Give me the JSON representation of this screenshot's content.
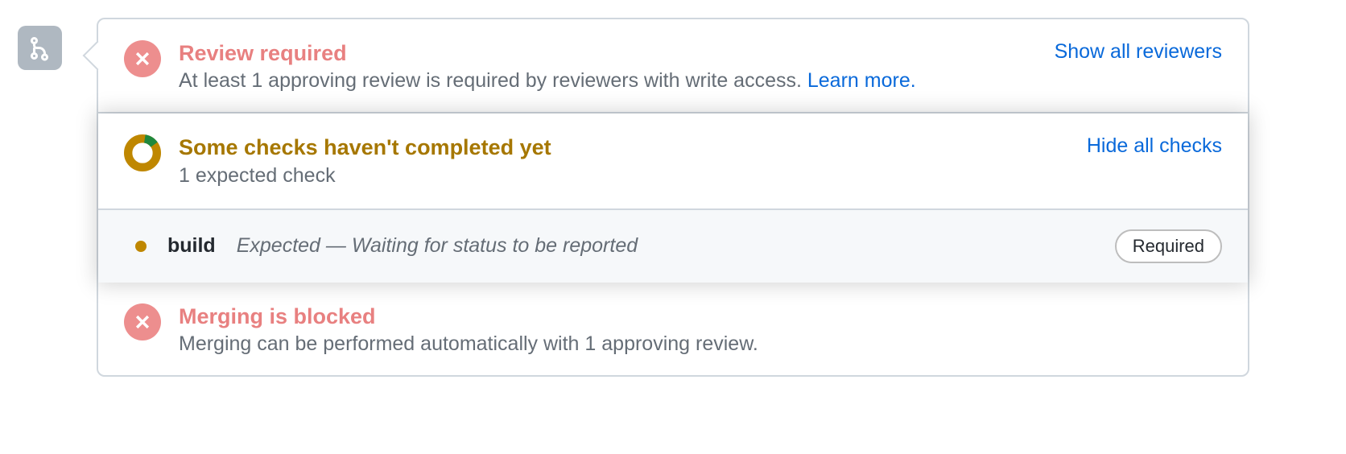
{
  "review": {
    "title": "Review required",
    "description": "At least 1 approving review is required by reviewers with write access. ",
    "learn_more": "Learn more.",
    "action": "Show all reviewers"
  },
  "checks": {
    "title": "Some checks haven't completed yet",
    "description": "1 expected check",
    "action": "Hide all checks",
    "items": [
      {
        "name": "build",
        "status": "Expected — Waiting for status to be reported",
        "badge": "Required"
      }
    ]
  },
  "blocked": {
    "title": "Merging is blocked",
    "description": "Merging can be performed automatically with 1 approving review."
  }
}
